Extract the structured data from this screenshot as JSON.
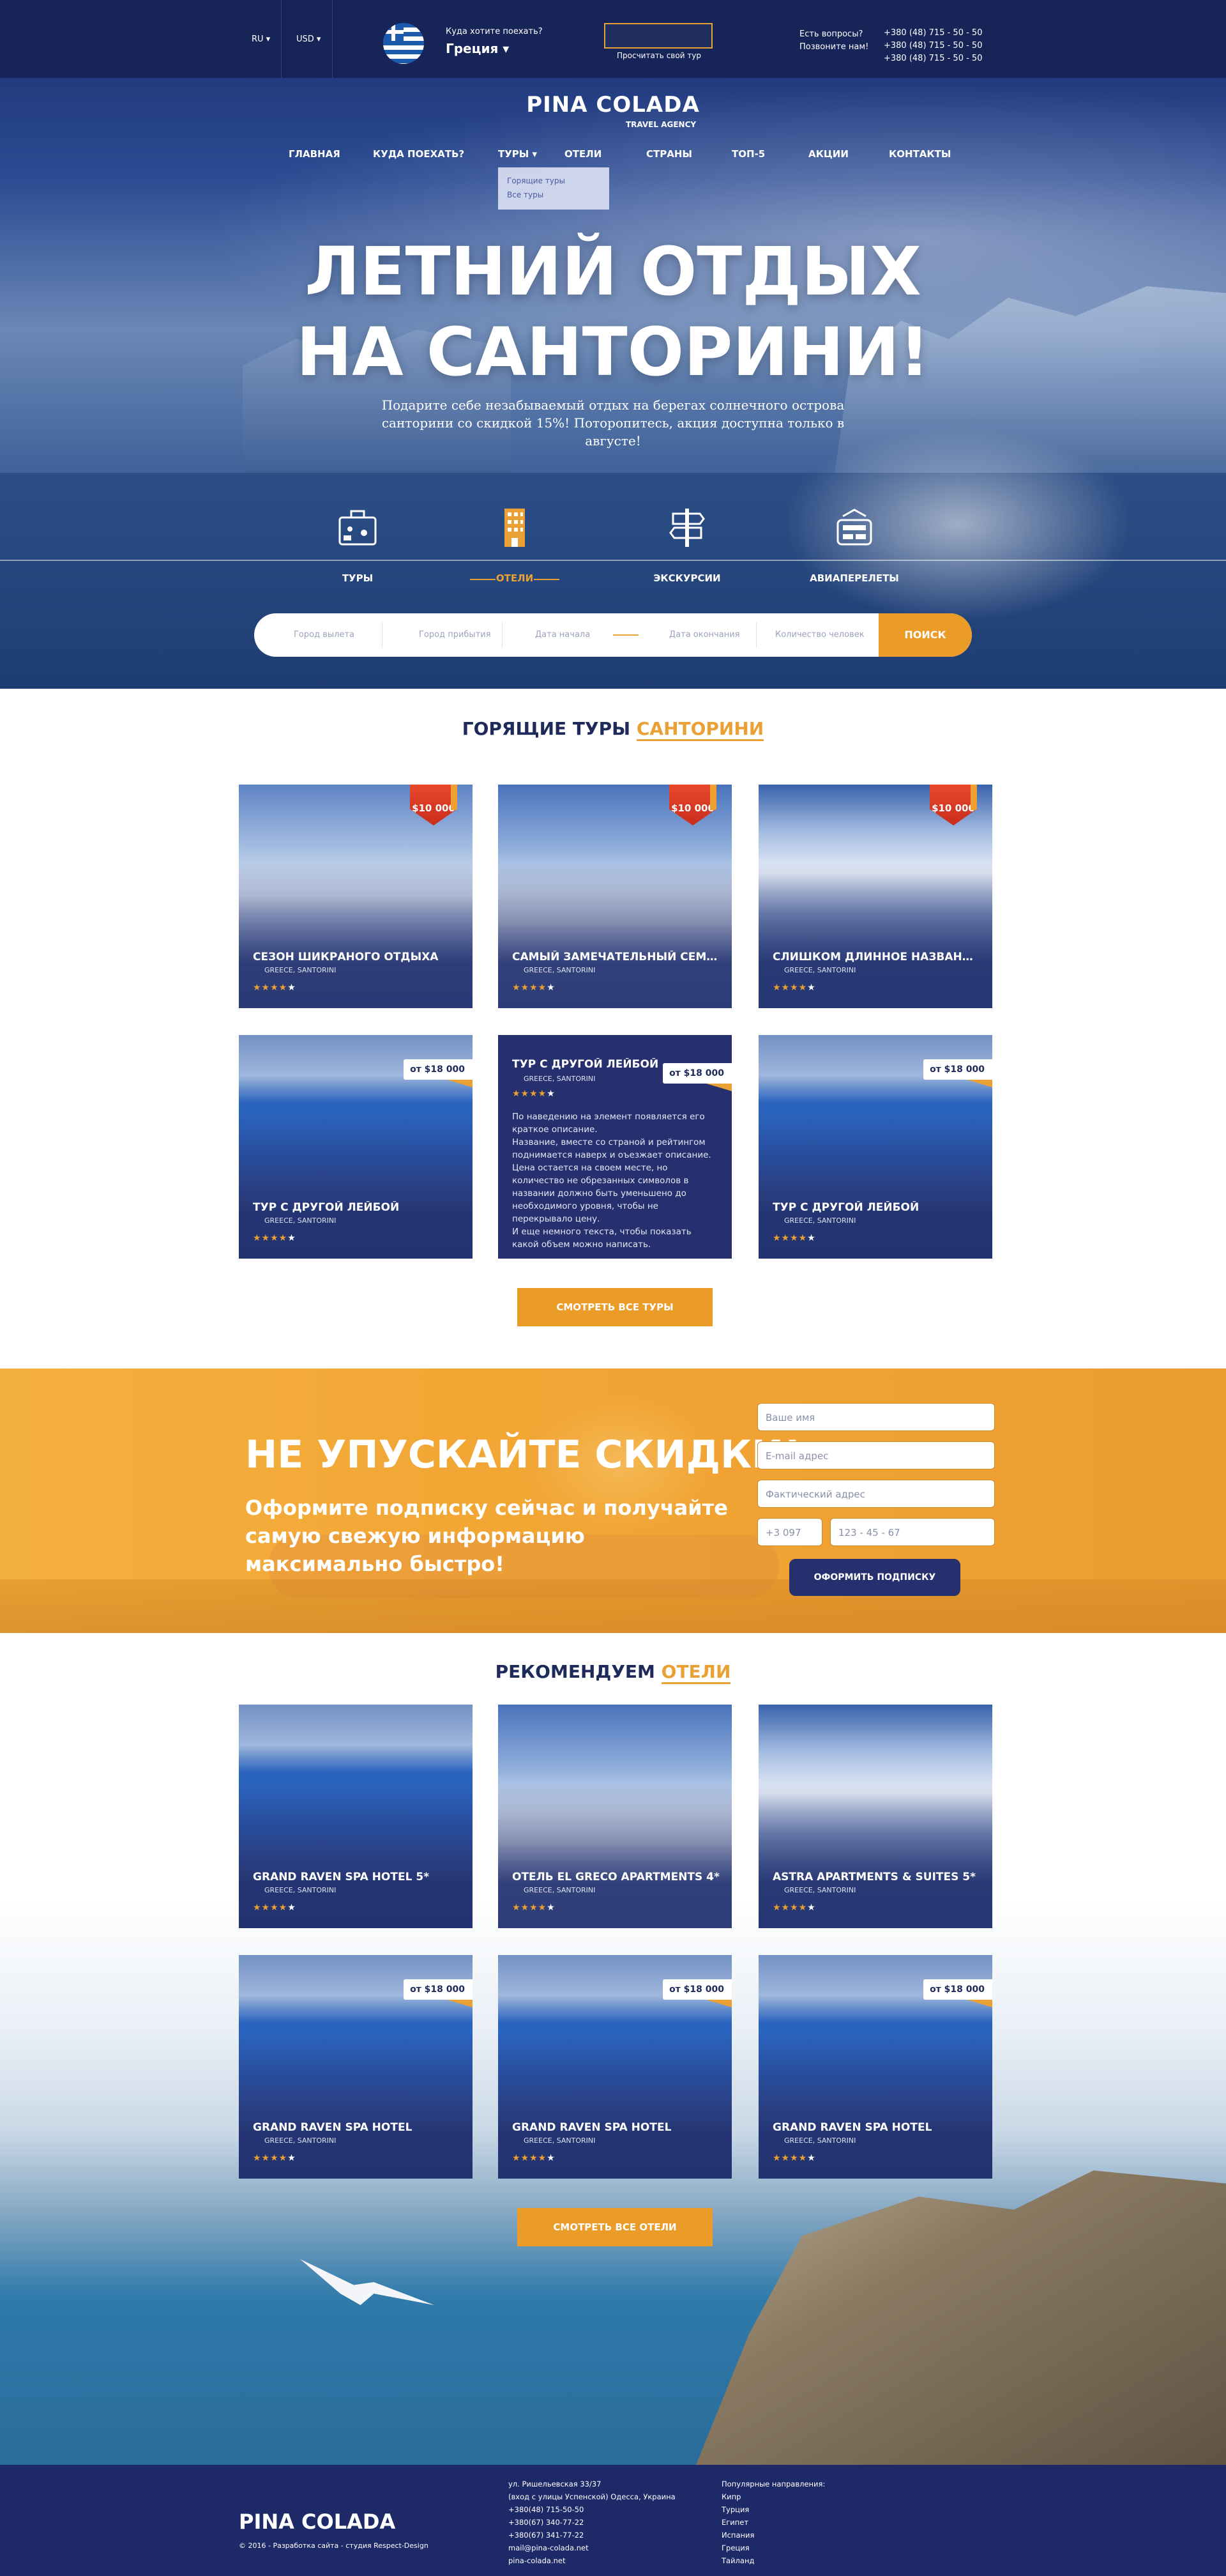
{
  "topbar": {
    "lang": "RU ▾",
    "currency": "USD ▾",
    "dest_question": "Куда хотите поехать?",
    "dest_value": "Греция",
    "calc_label": "Просчитать свой тур",
    "ask_line1": "Есть вопросы?",
    "ask_line2": "Позвоните нам!",
    "phone1": "+380 (48) 715 - 50 - 50",
    "phone2": "+380 (48) 715 - 50 - 50",
    "phone3": "+380 (48) 715 - 50 - 50"
  },
  "logo": {
    "name": "PINA COLADA",
    "sub": "TRAVEL AGENCY"
  },
  "nav": {
    "items": [
      "ГЛАВНАЯ",
      "КУДА ПОЕХАТЬ?",
      "ТУРЫ ▾",
      "ОТЕЛИ",
      "СТРАНЫ",
      "ТОП-5",
      "АКЦИИ",
      "КОНТАКТЫ"
    ],
    "dropdown": [
      "Горящие туры",
      "Все туры"
    ]
  },
  "hero": {
    "title1": "ЛЕТНИЙ ОТДЫХ",
    "title2": "НА САНТОРИНИ!",
    "lead": "Подарите себе незабываемый отдых на берегах солнечного острова санторини со скидкой 15%! Поторопитесь, акция доступна только в августе!"
  },
  "categories": [
    {
      "label": "ТУРЫ",
      "icon": "suitcase-icon"
    },
    {
      "label": "ОТЕЛИ",
      "icon": "hotel-icon"
    },
    {
      "label": "ЭКСКУРСИИ",
      "icon": "signpost-icon"
    },
    {
      "label": "АВИАПЕРЕЛЕТЫ",
      "icon": "plane-icon"
    }
  ],
  "search": {
    "from": "Город вылета",
    "to": "Город прибытия",
    "date_start": "Дата начала",
    "date_end": "Дата окончания",
    "people": "Количество человек",
    "button": "ПОИСК"
  },
  "hot_tours": {
    "title": "ГОРЯЩИЕ ТУРЫ",
    "title_accent": "САНТОРИНИ",
    "button": "СМОТРЕТЬ ВСЕ ТУРЫ",
    "cards": [
      {
        "title": "СЕЗОН ШИКРАНОГО ОТДЫХА",
        "loc": "GREECE, SANTORINI",
        "badge": "$10 000",
        "stars": 4
      },
      {
        "title": "САМЫЙ ЗАМЕЧАТЕЛЬНЫЙ СЕМЕЙНЫЙ ТУР",
        "loc": "GREECE, SANTORINI",
        "badge": "$10 000",
        "stars": 4
      },
      {
        "title": "СЛИШКОМ ДЛИННОЕ НАЗВАНИЕ ДЛЯ КРУТОГО ТУРА",
        "loc": "GREECE, SANTORINI",
        "badge": "$10 000",
        "stars": 4
      },
      {
        "title": "ТУР С ДРУГОЙ ЛЕЙБОЙ",
        "loc": "GREECE, SANTORINI",
        "price": "от $18 000",
        "stars": 4
      },
      {
        "title": "ТУР С ДРУГОЙ ЛЕЙБОЙ",
        "loc": "GREECE, SANTORINI",
        "price": "от $18 000",
        "stars": 4,
        "desc": "По наведению на элемент появляется его краткое описание.\nНазвание, вместе со страной и рейтингом поднимается наверх и оъезжает описание.\nЦена остается на своем месте, но количество не обрезанных символов в названии должно быть уменьшено до необходимого уровня, чтобы не перекрывало цену.\nИ еще немного текста, чтобы показать какой объем можно написать."
      },
      {
        "title": "ТУР С ДРУГОЙ ЛЕЙБОЙ",
        "loc": "GREECE, SANTORINI",
        "price": "от $18 000",
        "stars": 4
      }
    ]
  },
  "promo": {
    "title": "НЕ УПУСКАЙТЕ СКИДКИ!",
    "sub": "Оформите подписку сейчас и получайте самую свежую информацию максимально быстро!",
    "name_ph": "Ваше имя",
    "email_ph": "E-mail адрес",
    "addr_ph": "Фактический адрес",
    "code_ph": "+3 097",
    "phone_ph": "123 - 45 - 67",
    "button": "ОФОРМИТЬ ПОДПИСКУ"
  },
  "hotels": {
    "title": "РЕКОМЕНДУЕМ",
    "title_accent": "ОТЕЛИ",
    "button": "СМОТРЕТЬ ВСЕ ОТЕЛИ",
    "cards": [
      {
        "title": "GRAND RAVEN SPA HOTEL 5*",
        "loc": "GREECE, SANTORINI",
        "stars": 4
      },
      {
        "title": "ОТЕЛЬ EL GRECO APARTMENTS 4*",
        "loc": "GREECE, SANTORINI",
        "stars": 4
      },
      {
        "title": "ASTRA APARTMENTS & SUITES 5*",
        "loc": "GREECE, SANTORINI",
        "stars": 4
      },
      {
        "title": "GRAND RAVEN SPA HOTEL",
        "loc": "GREECE, SANTORINI",
        "price": "от $18 000",
        "stars": 4
      },
      {
        "title": "GRAND RAVEN SPA HOTEL",
        "loc": "GREECE, SANTORINI",
        "price": "от $18 000",
        "stars": 4
      },
      {
        "title": "GRAND RAVEN SPA HOTEL",
        "loc": "GREECE, SANTORINI",
        "price": "от $18 000",
        "stars": 4
      }
    ]
  },
  "footer": {
    "logo": "PINA COLADA",
    "copy": "© 2016 - Разработка сайта - студия Respect-Design",
    "address": [
      "ул. Ришельевская 33/37",
      "(вход с улицы Успенской) Одесса, Украина",
      "+380(48) 715-50-50",
      "+380(67) 340-77-22",
      "+380(67) 341-77-22",
      "mail@pina-colada.net",
      "pina-colada.net"
    ],
    "popular_title": "Популярные направления:",
    "popular": [
      "Кипр",
      "Турция",
      "Египет",
      "Испания",
      "Греция",
      "Тайланд"
    ]
  },
  "colors": {
    "navy": "#1e2a68",
    "accent": "#e9a034",
    "button": "#eb9c28"
  }
}
